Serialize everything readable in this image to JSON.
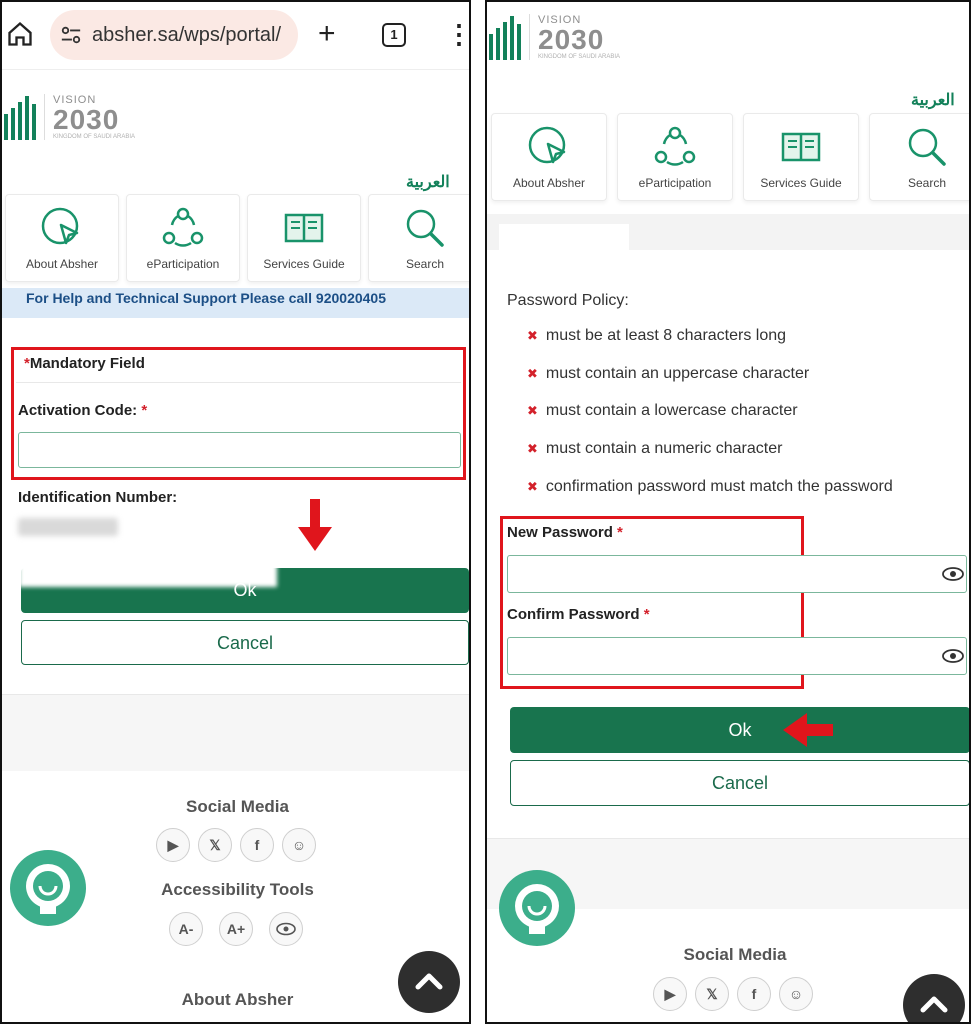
{
  "left": {
    "browser": {
      "url": "absher.sa/wps/portal/",
      "tabs_count": "1"
    },
    "logo": {
      "vision": "VISION",
      "year": "2030",
      "sub": "KINGDOM OF SAUDI ARABIA"
    },
    "language_link": "العربية",
    "nav": [
      {
        "label": "About Absher",
        "icon": "about-icon"
      },
      {
        "label": "eParticipation",
        "icon": "eparticipation-icon"
      },
      {
        "label": "Services Guide",
        "icon": "book-icon"
      },
      {
        "label": "Search",
        "icon": "search-icon"
      }
    ],
    "help_text": "For Help and Technical Support Please call 920020405",
    "mandatory_label": "Mandatory Field",
    "activation_label": "Activation Code:",
    "id_label": "Identification Number:",
    "ok_label": "Ok",
    "cancel_label": "Cancel",
    "social_title": "Social Media",
    "accessibility_title": "Accessibility Tools",
    "access_tools": [
      "A-",
      "A+"
    ],
    "about_title": "About Absher"
  },
  "right": {
    "logo": {
      "vision": "VISION",
      "year": "2030",
      "sub": "KINGDOM OF SAUDI ARABIA"
    },
    "language_link": "العربية",
    "nav": [
      {
        "label": "About Absher",
        "icon": "about-icon"
      },
      {
        "label": "eParticipation",
        "icon": "eparticipation-icon"
      },
      {
        "label": "Services Guide",
        "icon": "book-icon"
      },
      {
        "label": "Search",
        "icon": "search-icon"
      }
    ],
    "policy_title": "Password Policy:",
    "policy_items": [
      "must be at least 8 characters long",
      "must contain an uppercase character",
      "must contain a lowercase character",
      "must contain a numeric character",
      "confirmation password must match the password"
    ],
    "new_password_label": "New Password",
    "confirm_password_label": "Confirm Password",
    "ok_label": "Ok",
    "cancel_label": "Cancel",
    "social_title": "Social Media"
  },
  "colors": {
    "brand_green": "#18744e",
    "highlight_red": "#e0151c",
    "help_bg": "#dbe9f7"
  }
}
